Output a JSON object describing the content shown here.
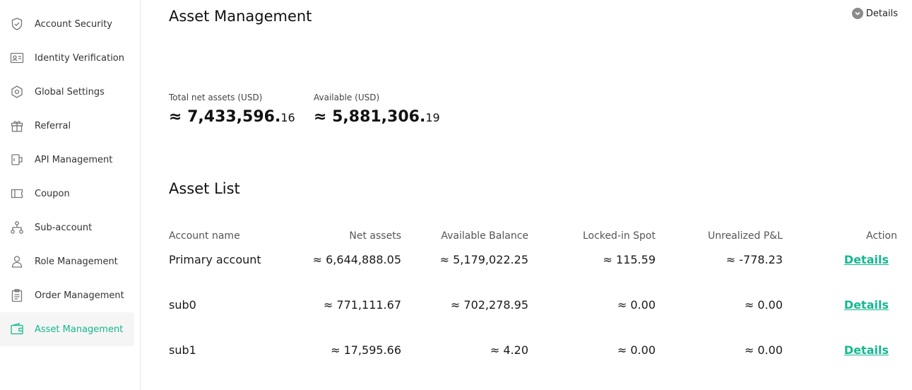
{
  "sidebar": {
    "items": [
      {
        "label": "Account Security",
        "icon": "shield-check-icon"
      },
      {
        "label": "Identity Verification",
        "icon": "id-card-icon"
      },
      {
        "label": "Global Settings",
        "icon": "hexagon-settings-icon"
      },
      {
        "label": "Referral",
        "icon": "gift-icon"
      },
      {
        "label": "API Management",
        "icon": "api-icon"
      },
      {
        "label": "Coupon",
        "icon": "ticket-icon"
      },
      {
        "label": "Sub-account",
        "icon": "hierarchy-icon"
      },
      {
        "label": "Role Management",
        "icon": "user-icon"
      },
      {
        "label": "Order Management",
        "icon": "clipboard-icon"
      },
      {
        "label": "Asset Management",
        "icon": "wallet-icon",
        "active": true
      }
    ]
  },
  "main": {
    "title": "Asset Management",
    "details_label": "Details",
    "stats": {
      "total": {
        "label": "Total net assets (USD)",
        "value_main": "≈ 7,433,596.",
        "value_dec": "16"
      },
      "available": {
        "label": "Available (USD)",
        "value_main": "≈ 5,881,306.",
        "value_dec": "19"
      }
    },
    "asset_list": {
      "title": "Asset List",
      "headers": {
        "name": "Account name",
        "net": "Net assets",
        "avail": "Available Balance",
        "locked": "Locked-in Spot",
        "pnl": "Unrealized P&L",
        "action": "Action"
      },
      "rows": [
        {
          "name": "Primary account",
          "net": "≈ 6,644,888.05",
          "avail": "≈ 5,179,022.25",
          "locked": "≈ 115.59",
          "pnl": "≈ -778.23",
          "action": "Details"
        },
        {
          "name": "sub0",
          "net": "≈ 771,111.67",
          "avail": "≈ 702,278.95",
          "locked": "≈ 0.00",
          "pnl": "≈ 0.00",
          "action": "Details"
        },
        {
          "name": "sub1",
          "net": "≈ 17,595.66",
          "avail": "≈ 4.20",
          "locked": "≈ 0.00",
          "pnl": "≈ 0.00",
          "action": "Details"
        }
      ]
    }
  },
  "colors": {
    "accent": "#14b88f",
    "active_bg": "#f5f5f5",
    "border": "#e6e6e6"
  }
}
